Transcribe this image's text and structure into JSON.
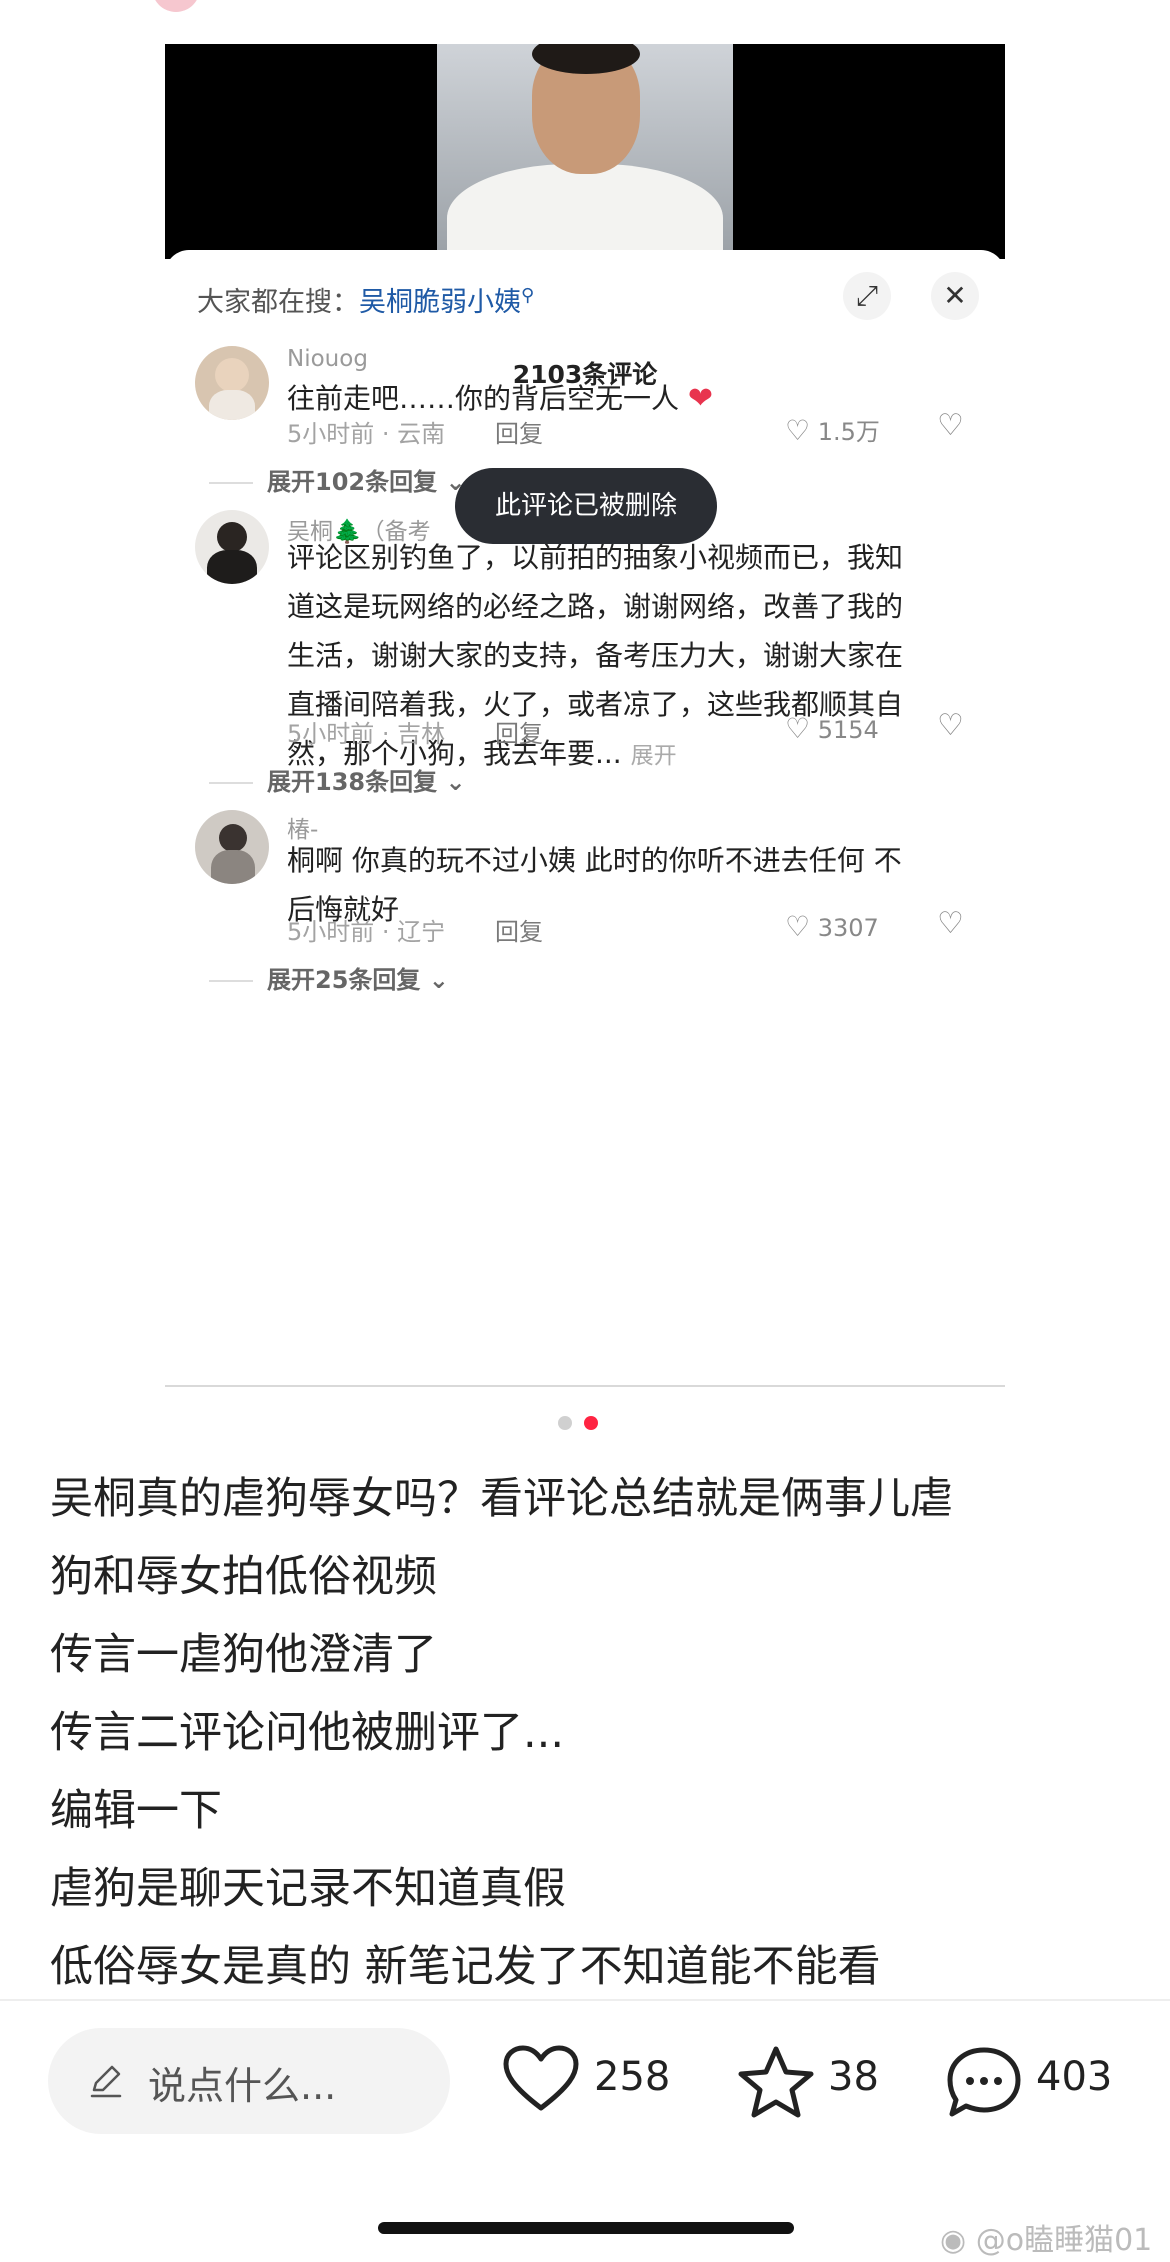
{
  "sheet": {
    "search_prefix": "大家都在搜：",
    "search_keyword": "吴桐脆弱小姨",
    "comment_count": "2103条评论"
  },
  "comments": [
    {
      "user": "Niouog",
      "text": "往前走吧……你的背后空无一人",
      "meta": "5小时前 · 云南",
      "reply": "回复",
      "likes": "1.5万",
      "expand": "展开102条回复"
    },
    {
      "user": "吴桐🌲（备考",
      "lines": [
        "评论区别钓鱼了，以前拍的抽象小视频而已，我知",
        "道这是玩网络的必经之路，谢谢网络，改善了我的",
        "生活，谢谢大家的支持，备考压力大，谢谢大家在",
        "直播间陪着我，火了，或者凉了，这些我都顺其自",
        "然，那个小狗，我去年要..."
      ],
      "more": "展开",
      "meta": "5小时前 · 吉林",
      "reply": "回复",
      "likes": "5154",
      "expand": "展开138条回复"
    },
    {
      "user": "椿-",
      "lines": [
        "桐啊 你真的玩不过小姨 此时的你听不进去任何 不",
        "后悔就好"
      ],
      "meta": "5小时前 · 辽宁",
      "reply": "回复",
      "likes": "3307",
      "expand": "展开25条回复"
    }
  ],
  "toast": "此评论已被删除",
  "post_lines": [
    "吴桐真的虐狗辱女吗？看评论总结就是俩事儿虐",
    "狗和辱女拍低俗视频",
    "传言一虐狗他澄清了",
    "传言二评论问他被删评了...",
    "编辑一下",
    "虐狗是聊天记录不知道真假",
    "低俗辱女是真的 新笔记发了不知道能不能看"
  ],
  "bottom_bar": {
    "comment_placeholder": "说点什么...",
    "likes": "258",
    "stars": "38",
    "comments": "403"
  },
  "watermark": "@o瞌睡猫01",
  "colors": {
    "accent_red": "#ff2442",
    "link_blue": "#1f5aa6",
    "heart_red": "#e8344e"
  }
}
